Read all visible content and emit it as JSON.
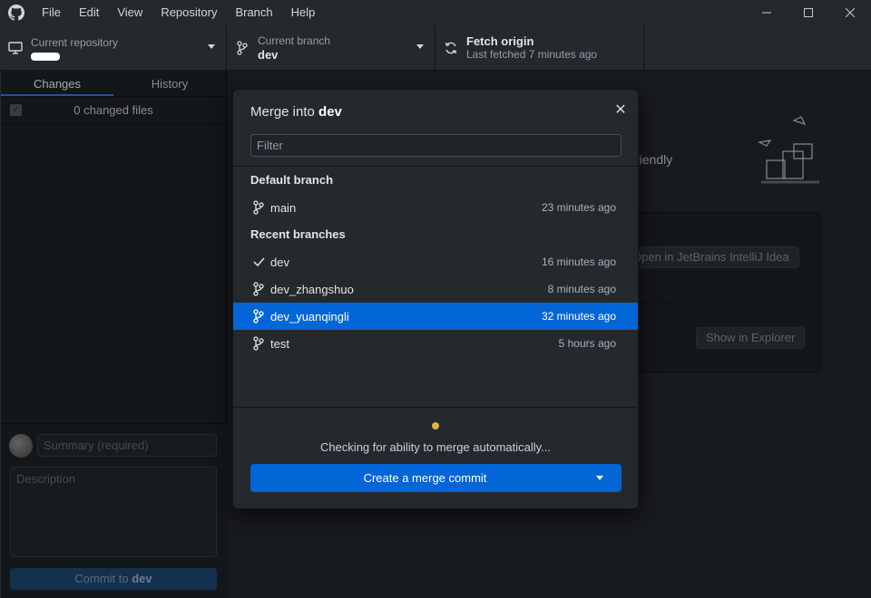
{
  "menu": [
    "File",
    "Edit",
    "View",
    "Repository",
    "Branch",
    "Help"
  ],
  "toolbar": {
    "repo_label": "Current repository",
    "branch_label": "Current branch",
    "branch_value": "dev",
    "fetch_title": "Fetch origin",
    "fetch_sub": "Last fetched 7 minutes ago"
  },
  "sidebar": {
    "tabs": [
      "Changes",
      "History"
    ],
    "changed_files": "0 changed files",
    "summary_placeholder": "Summary (required)",
    "description_placeholder": "Description",
    "commit_prefix": "Commit to ",
    "commit_branch": "dev"
  },
  "main": {
    "friendly_text": "riendly",
    "open_editor": "Open in JetBrains IntelliJ Idea",
    "show_explorer": "Show in Explorer"
  },
  "dialog": {
    "title_prefix": "Merge into ",
    "title_branch": "dev",
    "filter_placeholder": "Filter",
    "default_group": "Default branch",
    "recent_group": "Recent branches",
    "branches": [
      {
        "name": "main",
        "time": "23 minutes ago",
        "icon": "branch-icon"
      },
      {
        "name": "dev",
        "time": "16 minutes ago",
        "icon": "check-icon"
      },
      {
        "name": "dev_zhangshuo",
        "time": "8 minutes ago",
        "icon": "branch-icon"
      },
      {
        "name": "dev_yuanqingli",
        "time": "32 minutes ago",
        "icon": "branch-icon",
        "selected": true
      },
      {
        "name": "test",
        "time": "5 hours ago",
        "icon": "branch-icon"
      }
    ],
    "status": "Checking for ability to merge automatically...",
    "merge_button": "Create a merge commit"
  },
  "colors": {
    "accent": "#0366d6",
    "status_dot": "#e3b341",
    "background": "#24292e"
  }
}
